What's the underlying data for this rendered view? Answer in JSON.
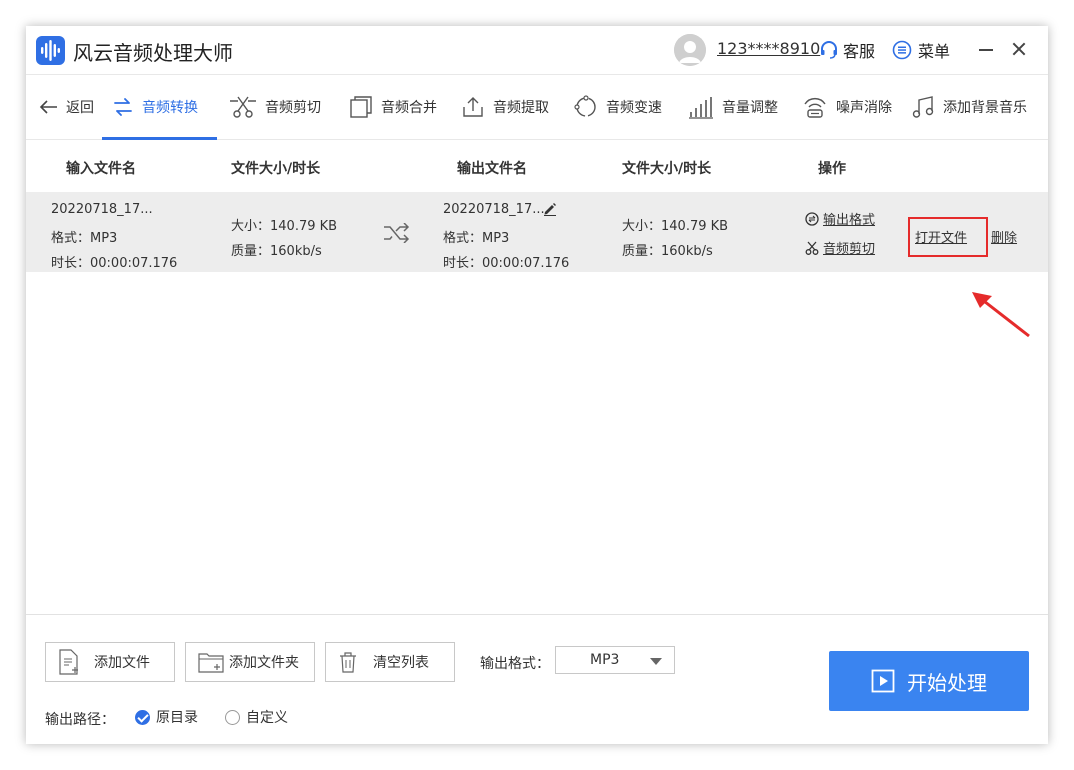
{
  "app": {
    "title": "风云音频处理大师"
  },
  "user": {
    "name": "123****8910"
  },
  "header": {
    "service_label": "客服",
    "menu_label": "菜单"
  },
  "toolbar": {
    "back_label": "返回",
    "items": [
      {
        "label": "音频转换",
        "icon": "convert-icon",
        "active": true
      },
      {
        "label": "音频剪切",
        "icon": "cut-icon"
      },
      {
        "label": "音频合并",
        "icon": "merge-icon"
      },
      {
        "label": "音频提取",
        "icon": "extract-icon"
      },
      {
        "label": "音频变速",
        "icon": "speed-icon"
      },
      {
        "label": "音量调整",
        "icon": "volume-icon"
      },
      {
        "label": "噪声消除",
        "icon": "noise-icon"
      },
      {
        "label": "添加背景音乐",
        "icon": "music-icon"
      }
    ]
  },
  "table": {
    "headers": [
      "输入文件名",
      "文件大小/时长",
      "输出文件名",
      "文件大小/时长",
      "操作"
    ],
    "rows": [
      {
        "input_name": "20220718_17...",
        "input_format": "格式：MP3",
        "input_duration": "时长：00:00:07.176",
        "input_size": "大小：140.79 KB",
        "input_quality": "质量：160kb/s",
        "output_name": "20220718_17...",
        "output_format": "格式：MP3",
        "output_duration": "时长：00:00:07.176",
        "output_size": "大小：140.79 KB",
        "output_quality": "质量：160kb/s",
        "action_output_format": "输出格式",
        "action_audio_cut": "音频剪切",
        "action_open_file": "打开文件",
        "action_delete": "删除"
      }
    ]
  },
  "bottom": {
    "add_file": "添加文件",
    "add_folder": "添加文件夹",
    "clear_list": "清空列表",
    "output_format_label": "输出格式：",
    "output_format_value": "MP3",
    "output_path_label": "输出路径：",
    "path_options": [
      {
        "label": "原目录",
        "checked": true
      },
      {
        "label": "自定义",
        "checked": false
      }
    ],
    "start_label": "开始处理"
  },
  "colors": {
    "accent": "#2f6fe4",
    "button": "#3a84f0",
    "highlight": "#e52b2b"
  }
}
